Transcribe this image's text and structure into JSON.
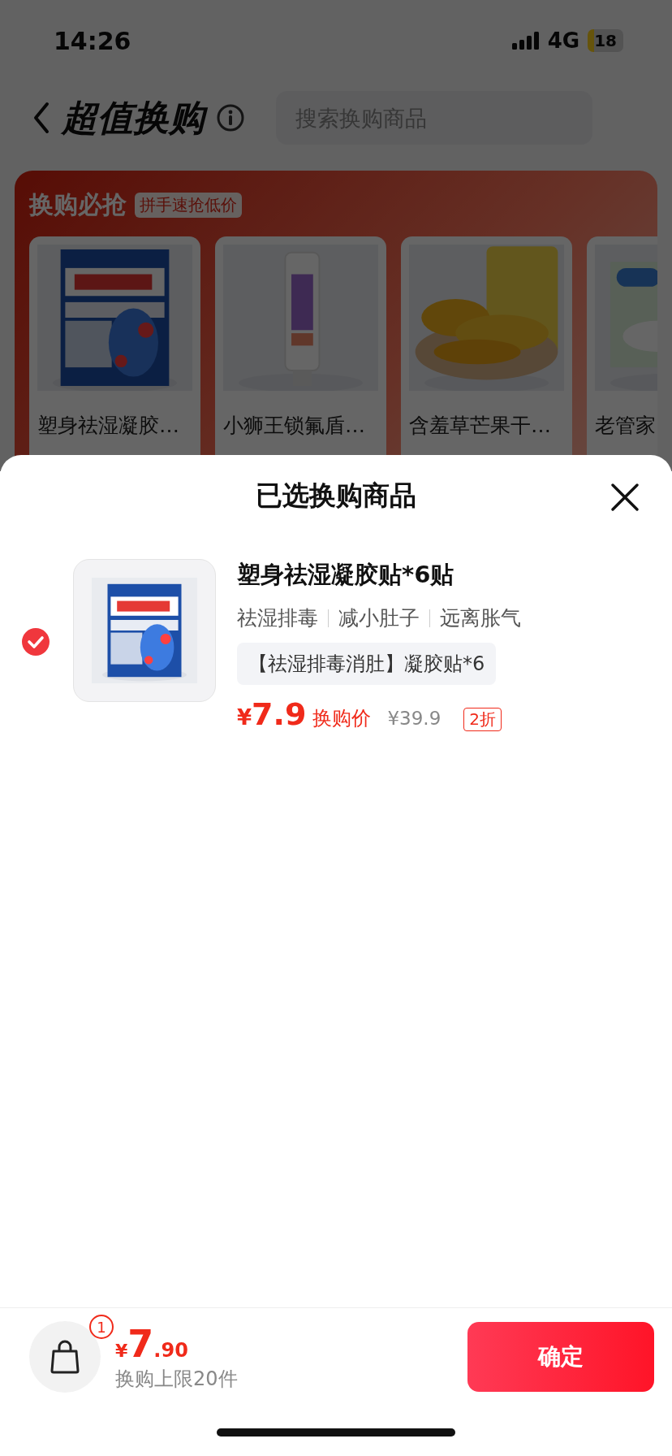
{
  "status_bar": {
    "time": "14:26",
    "network": "4G",
    "battery": "18"
  },
  "header": {
    "title": "超值换购",
    "search": {
      "placeholder": "搜索换购商品"
    }
  },
  "promo": {
    "title": "换购必抢",
    "tag": "拼手速抢低价",
    "items": [
      {
        "name": "塑身祛湿凝胶…"
      },
      {
        "name": "小狮王锁氟盾…"
      },
      {
        "name": "含羞草芒果干…"
      },
      {
        "name": "老管家"
      }
    ]
  },
  "sheet": {
    "title": "已选换购商品",
    "items": [
      {
        "selected": true,
        "title": "塑身祛湿凝胶贴*6贴",
        "tags": [
          "祛湿排毒",
          "减小肚子",
          "远离胀气"
        ],
        "spec": "【祛湿排毒消肚】凝胶贴*6",
        "price_symbol": "¥",
        "price": "7.9",
        "price_label": "换购价",
        "original_price": "¥39.9",
        "discount": "2折"
      }
    ]
  },
  "footer": {
    "cart_count": "1",
    "total_symbol": "¥",
    "total_integer": "7",
    "total_decimal": ".90",
    "limit": "换购上限20件",
    "confirm": "确定"
  }
}
